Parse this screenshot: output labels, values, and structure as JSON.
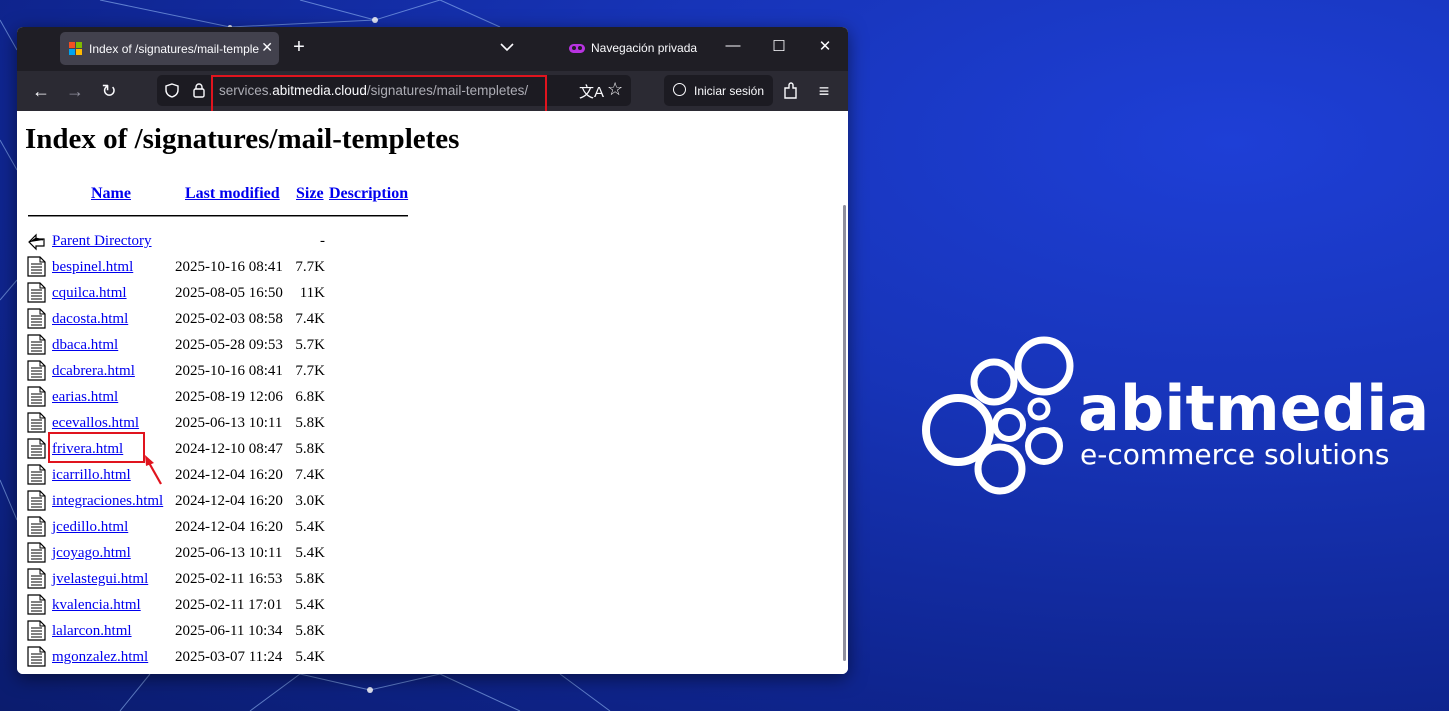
{
  "browser": {
    "tab_title": "Index of /signatures/mail-templetes",
    "private_label": "Navegación privada",
    "url_prefix": "services.",
    "url_domain": "abitmedia.cloud",
    "url_path": "/signatures/mail-templetes/",
    "signin_label": "Iniciar sesión"
  },
  "page": {
    "heading": "Index of /signatures/mail-templetes",
    "columns": {
      "name": "Name",
      "last_modified": "Last modified",
      "size": "Size",
      "description": "Description"
    },
    "rows": [
      {
        "name": "Parent Directory",
        "date": "",
        "size": "-",
        "icon": "back-icon"
      },
      {
        "name": "bespinel.html",
        "date": "2025-10-16 08:41",
        "size": "7.7K",
        "icon": "file-icon"
      },
      {
        "name": "cquilca.html",
        "date": "2025-08-05 16:50",
        "size": "11K",
        "icon": "file-icon"
      },
      {
        "name": "dacosta.html",
        "date": "2025-02-03 08:58",
        "size": "7.4K",
        "icon": "file-icon"
      },
      {
        "name": "dbaca.html",
        "date": "2025-05-28 09:53",
        "size": "5.7K",
        "icon": "file-icon"
      },
      {
        "name": "dcabrera.html",
        "date": "2025-10-16 08:41",
        "size": "7.7K",
        "icon": "file-icon"
      },
      {
        "name": "earias.html",
        "date": "2025-08-19 12:06",
        "size": "6.8K",
        "icon": "file-icon"
      },
      {
        "name": "ecevallos.html",
        "date": "2025-06-13 10:11",
        "size": "5.8K",
        "icon": "file-icon"
      },
      {
        "name": "frivera.html",
        "date": "2024-12-10 08:47",
        "size": "5.8K",
        "icon": "file-icon"
      },
      {
        "name": "icarrillo.html",
        "date": "2024-12-04 16:20",
        "size": "7.4K",
        "icon": "file-icon"
      },
      {
        "name": "integraciones.html",
        "date": "2024-12-04 16:20",
        "size": "3.0K",
        "icon": "file-icon"
      },
      {
        "name": "jcedillo.html",
        "date": "2024-12-04 16:20",
        "size": "5.4K",
        "icon": "file-icon"
      },
      {
        "name": "jcoyago.html",
        "date": "2025-06-13 10:11",
        "size": "5.4K",
        "icon": "file-icon"
      },
      {
        "name": "jvelastegui.html",
        "date": "2025-02-11 16:53",
        "size": "5.8K",
        "icon": "file-icon"
      },
      {
        "name": "kvalencia.html",
        "date": "2025-02-11 17:01",
        "size": "5.4K",
        "icon": "file-icon"
      },
      {
        "name": "lalarcon.html",
        "date": "2025-06-11 10:34",
        "size": "5.8K",
        "icon": "file-icon"
      },
      {
        "name": "mgonzalez.html",
        "date": "2025-03-07 11:24",
        "size": "5.4K",
        "icon": "file-icon"
      }
    ]
  },
  "logo": {
    "brand": "abitmedia",
    "tagline": "e-commerce solutions"
  },
  "colors": {
    "annotation": "#e0141e",
    "link": "#0000ee",
    "background": "#1734b8"
  }
}
